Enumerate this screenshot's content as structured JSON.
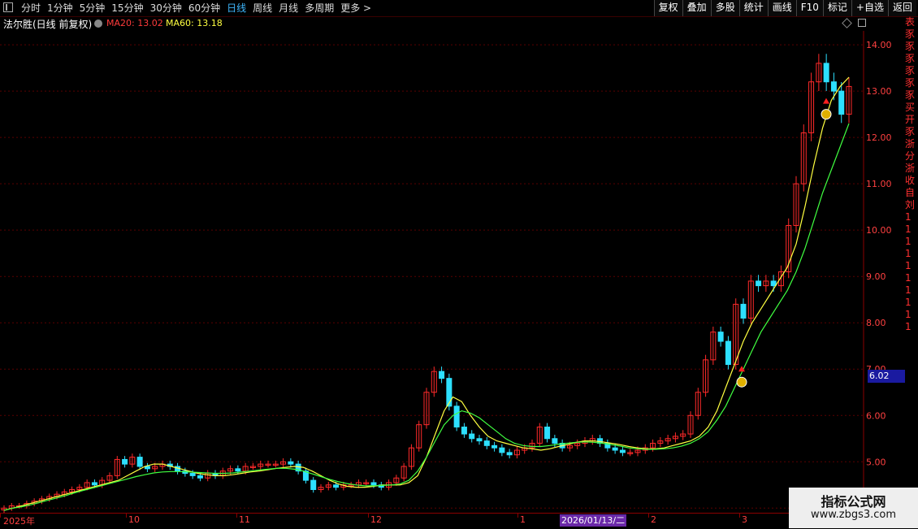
{
  "toolbar": {
    "tabs": [
      "分时",
      "1分钟",
      "5分钟",
      "15分钟",
      "30分钟",
      "60分钟",
      "日线",
      "周线",
      "月线",
      "多周期",
      "更多 >"
    ],
    "active_tab": "日线",
    "right_buttons": [
      "复权",
      "叠加",
      "多股",
      "统计",
      "画线",
      "F10",
      "标记",
      "+自选",
      "返回"
    ]
  },
  "info": {
    "stock": "法尔胜(日线 前复权)",
    "ma20": "MA20: 13.02",
    "ma60": "MA60: 13.18"
  },
  "price_tag": "6.02",
  "date_axis": [
    "2025年",
    "10",
    "11",
    "12",
    "1",
    "2026/01/13/二",
    "2",
    "3"
  ],
  "right_strip": [
    "表",
    "豕",
    "豕",
    "豕",
    "豕",
    "豕",
    "豕",
    "买",
    "开",
    "豕",
    "浙",
    "分",
    "浙",
    "收",
    "自",
    "刘",
    "1",
    "1",
    "1",
    "1",
    "1",
    "1",
    "1",
    "1",
    "1",
    "1"
  ],
  "watermark": {
    "line1": "指标公式网",
    "line2": "www.zbgs3.com"
  },
  "colors": {
    "up": "#ff2a2a",
    "down": "#2de0ff",
    "ma_fast": "#ffff40",
    "ma_slow": "#40ff40",
    "grid": "#5a0000"
  },
  "chart_data": {
    "type": "candlestick",
    "y_ticks": [
      "14.00",
      "13.00",
      "12.00",
      "11.00",
      "10.00",
      "9.00",
      "8.00",
      "7.00",
      "6.00",
      "5.00",
      "4.00"
    ],
    "ylim": [
      3.9,
      14.3
    ],
    "x_labels": [
      "2025年",
      "10",
      "11",
      "12",
      "1",
      "2",
      "3"
    ],
    "closes": [
      4.0,
      4.05,
      4.05,
      4.1,
      4.15,
      4.2,
      4.25,
      4.3,
      4.35,
      4.4,
      4.45,
      4.55,
      4.5,
      4.6,
      4.7,
      5.05,
      4.95,
      5.1,
      4.9,
      4.85,
      4.9,
      4.95,
      4.9,
      4.8,
      4.75,
      4.7,
      4.65,
      4.75,
      4.7,
      4.8,
      4.85,
      4.8,
      4.9,
      4.9,
      4.95,
      4.95,
      4.95,
      5.0,
      4.95,
      4.8,
      4.6,
      4.4,
      4.45,
      4.5,
      4.45,
      4.5,
      4.5,
      4.55,
      4.55,
      4.5,
      4.45,
      4.55,
      4.65,
      4.9,
      5.3,
      5.8,
      6.5,
      6.95,
      6.8,
      6.2,
      5.75,
      5.6,
      5.5,
      5.45,
      5.35,
      5.3,
      5.2,
      5.15,
      5.25,
      5.3,
      5.4,
      5.75,
      5.5,
      5.4,
      5.3,
      5.35,
      5.4,
      5.45,
      5.5,
      5.4,
      5.3,
      5.25,
      5.2,
      5.2,
      5.25,
      5.3,
      5.4,
      5.45,
      5.5,
      5.55,
      5.6,
      6.0,
      6.5,
      7.2,
      7.8,
      7.6,
      7.1,
      8.4,
      8.1,
      8.9,
      8.8,
      8.9,
      8.8,
      9.1,
      10.1,
      11.0,
      12.1,
      13.2,
      13.6,
      13.2,
      13.0,
      12.5,
      13.1
    ],
    "ma_fast": [
      3.95,
      4.0,
      4.05,
      4.1,
      4.15,
      4.2,
      4.25,
      4.3,
      4.35,
      4.4,
      4.45,
      4.5,
      4.55,
      4.6,
      4.7,
      4.8,
      4.9,
      4.95,
      4.95,
      4.9,
      4.85,
      4.8,
      4.75,
      4.72,
      4.7,
      4.7,
      4.72,
      4.75,
      4.78,
      4.8,
      4.83,
      4.86,
      4.88,
      4.9,
      4.88,
      4.8,
      4.7,
      4.6,
      4.52,
      4.47,
      4.45,
      4.45,
      4.47,
      4.5,
      4.5,
      4.5,
      4.55,
      4.7,
      5.1,
      5.6,
      6.1,
      6.4,
      6.3,
      6.0,
      5.75,
      5.55,
      5.45,
      5.4,
      5.35,
      5.3,
      5.28,
      5.25,
      5.28,
      5.33,
      5.37,
      5.42,
      5.45,
      5.45,
      5.43,
      5.4,
      5.37,
      5.33,
      5.3,
      5.28,
      5.28,
      5.3,
      5.35,
      5.4,
      5.45,
      5.55,
      5.75,
      6.1,
      6.6,
      7.1,
      7.6,
      8.0,
      8.3,
      8.6,
      8.9,
      9.2,
      9.7,
      10.5,
      11.4,
      12.2,
      12.8,
      13.1,
      13.3
    ],
    "ma_slow": [
      3.95,
      4.0,
      4.03,
      4.07,
      4.12,
      4.17,
      4.22,
      4.27,
      4.33,
      4.38,
      4.43,
      4.48,
      4.53,
      4.58,
      4.63,
      4.68,
      4.72,
      4.76,
      4.78,
      4.79,
      4.79,
      4.78,
      4.77,
      4.76,
      4.75,
      4.75,
      4.76,
      4.78,
      4.8,
      4.82,
      4.84,
      4.86,
      4.86,
      4.84,
      4.8,
      4.74,
      4.68,
      4.62,
      4.57,
      4.53,
      4.5,
      4.48,
      4.48,
      4.49,
      4.5,
      4.52,
      4.6,
      4.8,
      5.1,
      5.45,
      5.8,
      6.0,
      6.1,
      6.05,
      5.95,
      5.8,
      5.65,
      5.5,
      5.4,
      5.35,
      5.33,
      5.33,
      5.35,
      5.38,
      5.4,
      5.42,
      5.43,
      5.42,
      5.4,
      5.37,
      5.34,
      5.3,
      5.28,
      5.27,
      5.27,
      5.28,
      5.3,
      5.34,
      5.4,
      5.5,
      5.65,
      5.9,
      6.2,
      6.6,
      7.0,
      7.4,
      7.8,
      8.1,
      8.4,
      8.7,
      9.1,
      9.6,
      10.2,
      10.8,
      11.3,
      11.8,
      12.3
    ]
  }
}
